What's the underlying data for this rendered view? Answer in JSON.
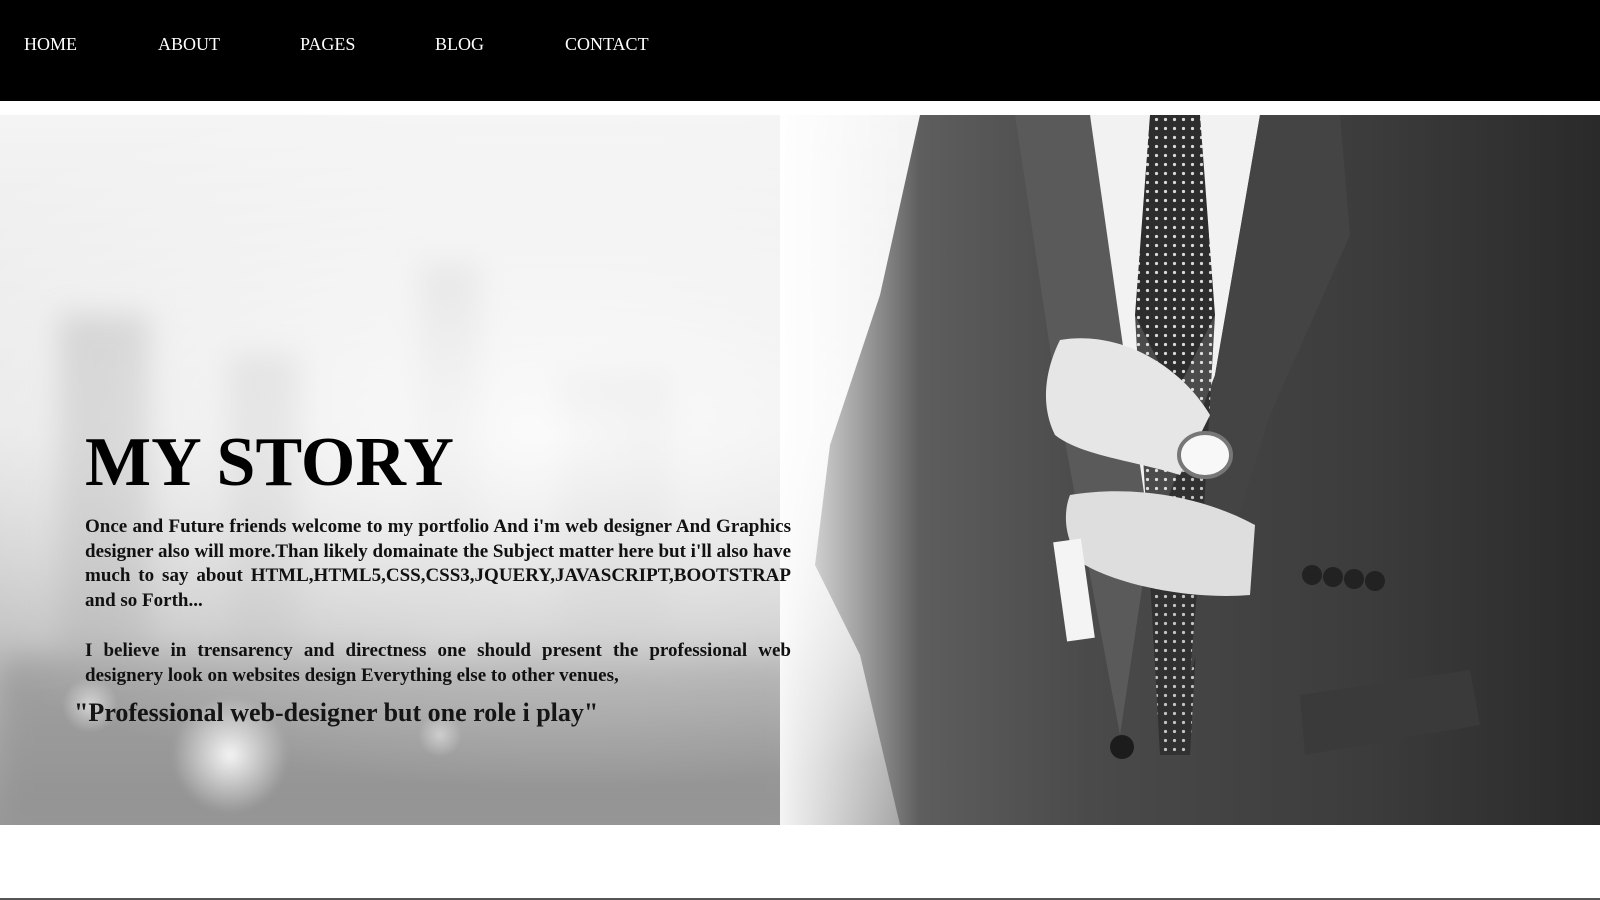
{
  "nav": {
    "items": [
      {
        "label": "HOME"
      },
      {
        "label": "ABOUT"
      },
      {
        "label": "PAGES"
      },
      {
        "label": "BLOG"
      },
      {
        "label": "CONTACT"
      }
    ]
  },
  "hero": {
    "title": "MY STORY",
    "paragraph_1": "Once and Future friends welcome to my portfolio And i'm web designer And Graphics designer also will more.Than likely domainate the Subject matter here but i'll also have much to say about HTML,HTML5,CSS,CSS3,JQUERY,JAVASCRIPT,BOOTSTRAP and so Forth...",
    "paragraph_2": "I believe in trensarency and directness one should present the professional web designery look on websites design Everything else to other venues,",
    "quote": "\"Professional web-designer but one role i play\""
  },
  "colors": {
    "navbar_bg": "#000000",
    "nav_text": "#ffffff",
    "page_bg": "#ffffff",
    "hero_text": "#000000"
  }
}
